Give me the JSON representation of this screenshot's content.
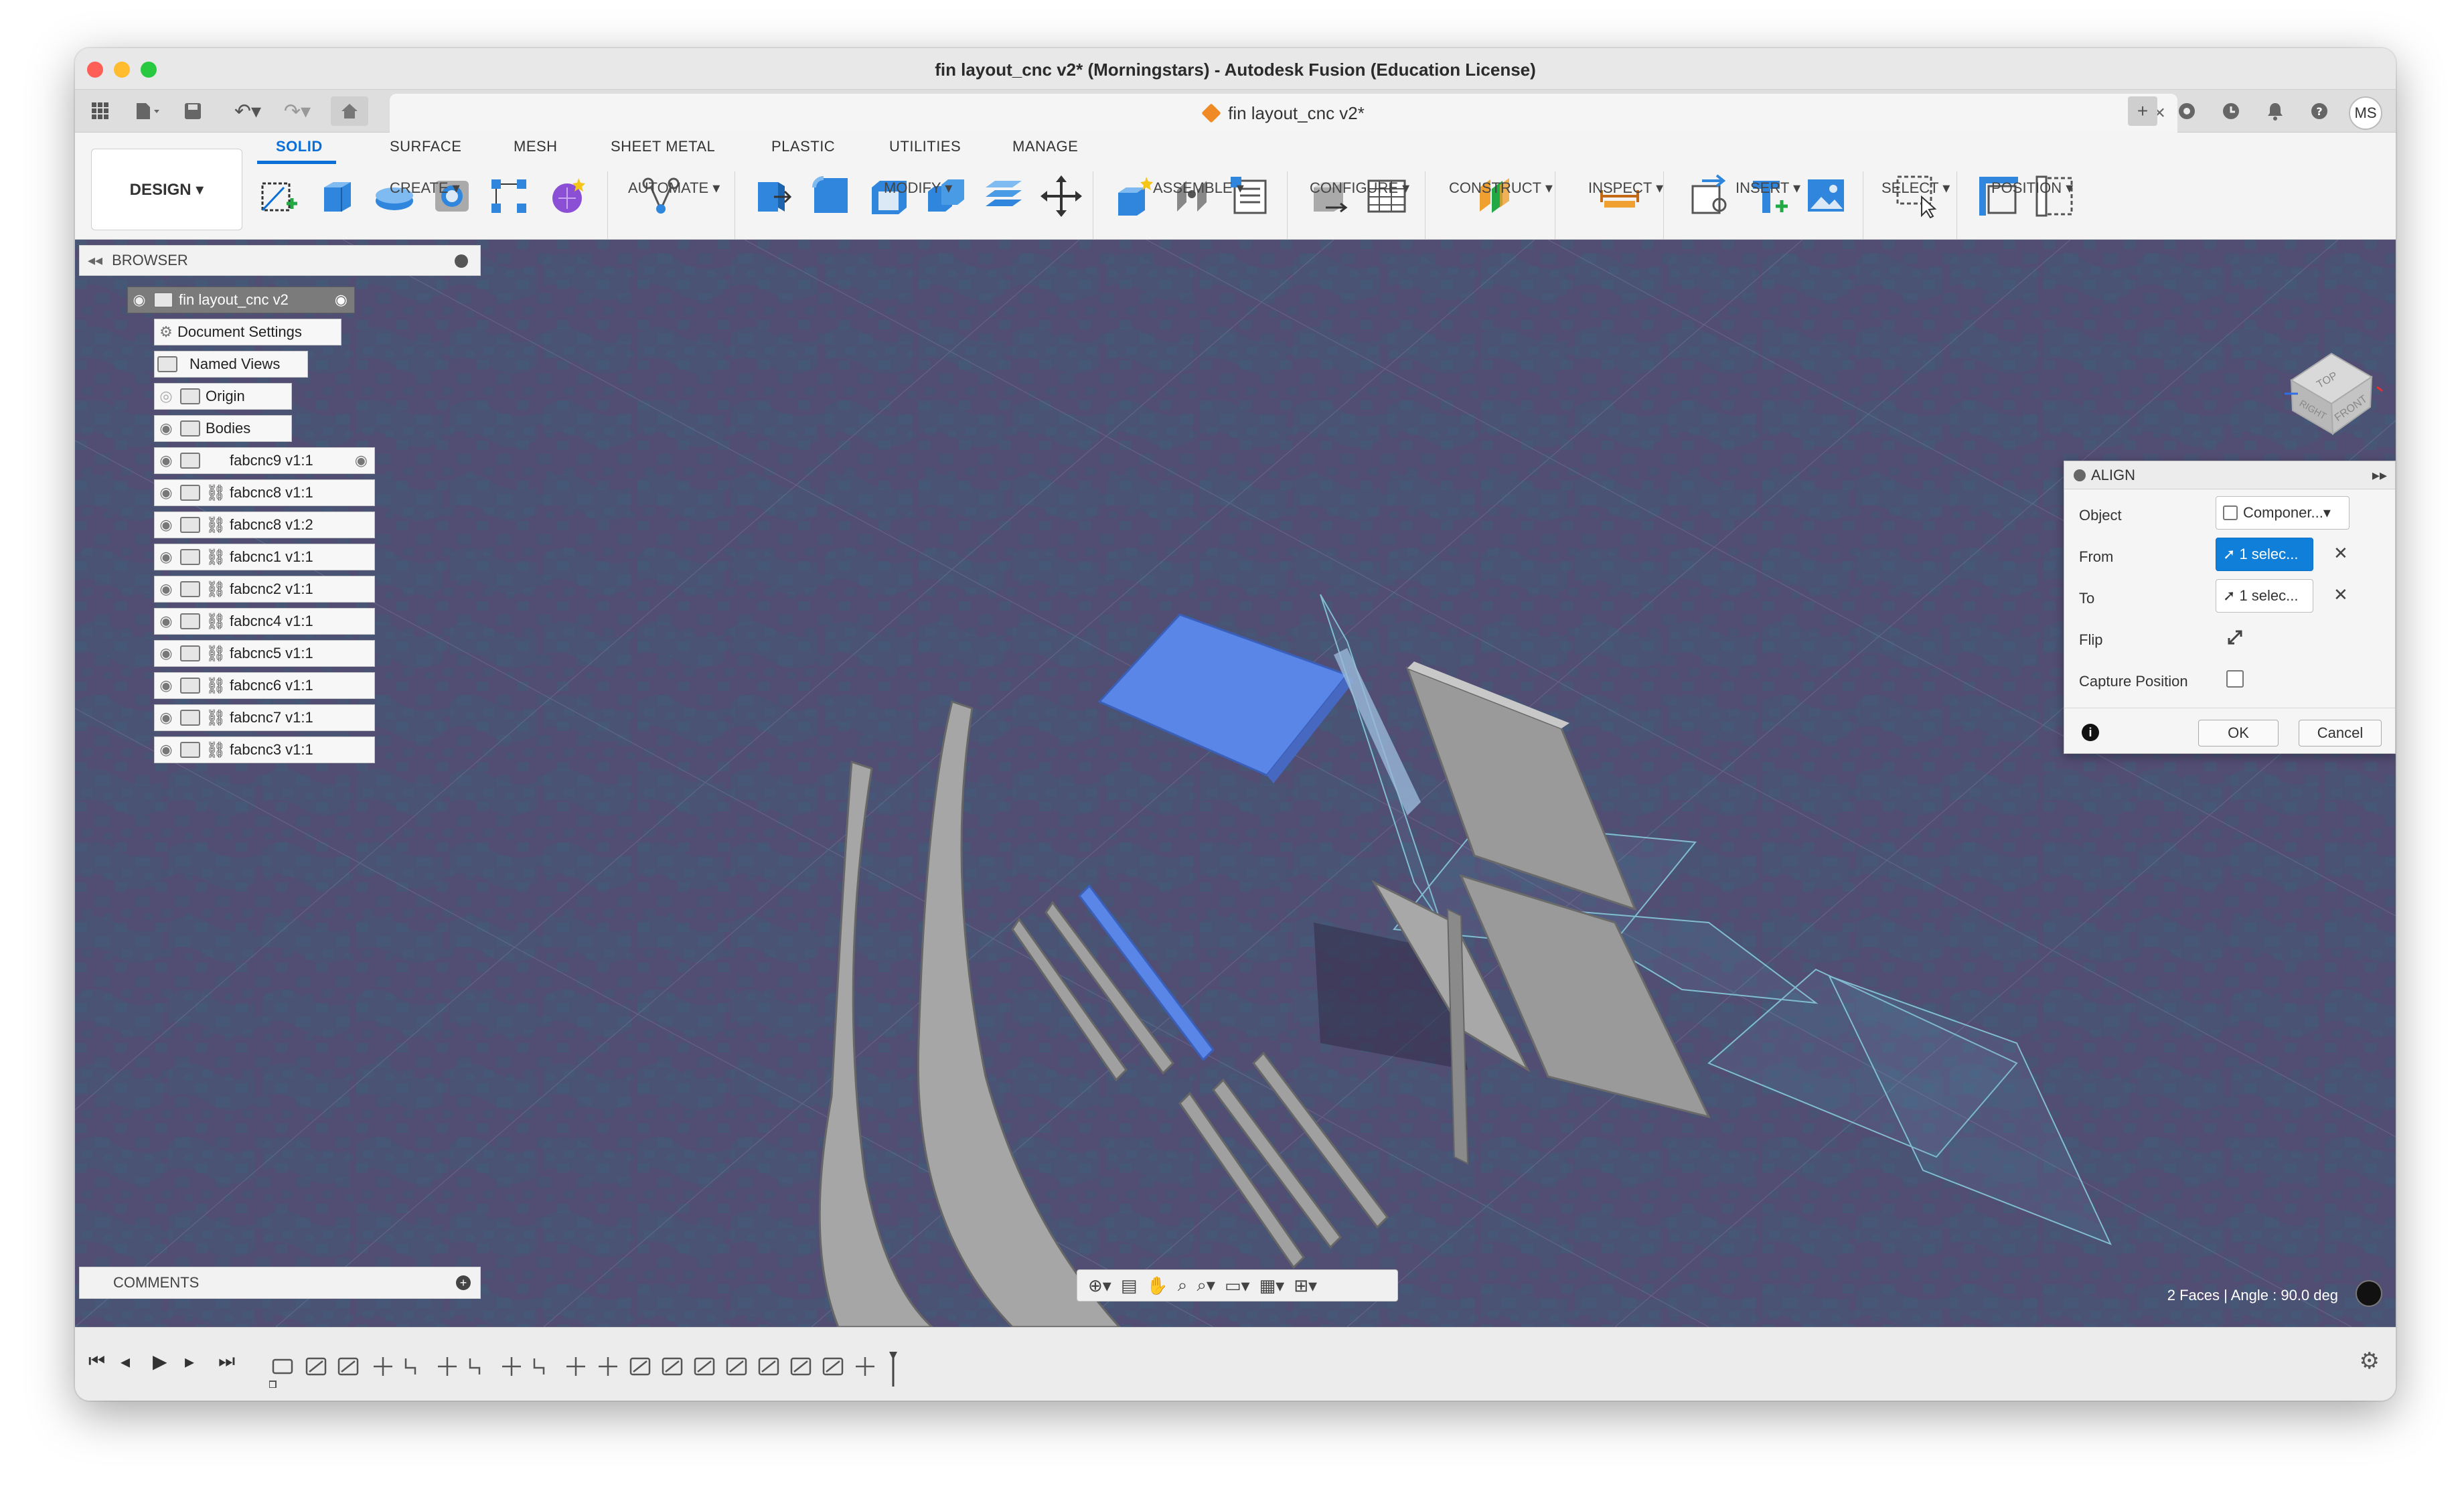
{
  "window": {
    "title": "fin layout_cnc v2* (Morningstars) - Autodesk Fusion (Education License)"
  },
  "document_tab": {
    "label": "fin layout_cnc v2*",
    "close": "×"
  },
  "user": {
    "initials": "MS"
  },
  "workspace": {
    "label": "DESIGN ▾"
  },
  "ribbon": {
    "tabs": [
      "SOLID",
      "SURFACE",
      "MESH",
      "SHEET METAL",
      "PLASTIC",
      "UTILITIES",
      "MANAGE"
    ],
    "active_tab": "SOLID",
    "groups": [
      "CREATE ▾",
      "AUTOMATE ▾",
      "MODIFY ▾",
      "ASSEMBLE ▾",
      "CONFIGURE ▾",
      "CONSTRUCT ▾",
      "INSPECT ▾",
      "INSERT ▾",
      "SELECT ▾",
      "POSITION ▾"
    ]
  },
  "browser": {
    "title": "BROWSER",
    "root": "fin layout_cnc v2",
    "nodes": [
      {
        "label": "Document Settings"
      },
      {
        "label": "Named Views"
      },
      {
        "label": "Origin"
      },
      {
        "label": "Bodies"
      },
      {
        "label": "fabcnc9 v1:1"
      },
      {
        "label": "fabcnc8 v1:1"
      },
      {
        "label": "fabcnc8 v1:2"
      },
      {
        "label": "fabcnc1 v1:1"
      },
      {
        "label": "fabcnc2 v1:1"
      },
      {
        "label": "fabcnc4 v1:1"
      },
      {
        "label": "fabcnc5 v1:1"
      },
      {
        "label": "fabcnc6 v1:1"
      },
      {
        "label": "fabcnc7 v1:1"
      },
      {
        "label": "fabcnc3 v1:1"
      }
    ]
  },
  "comments": {
    "title": "COMMENTS"
  },
  "align_dialog": {
    "title": "ALIGN",
    "object_label": "Object",
    "object_value": "Componer...▾",
    "from_label": "From",
    "from_value": "1 selec...",
    "to_label": "To",
    "to_value": "1 selec...",
    "flip_label": "Flip",
    "capture_label": "Capture Position",
    "ok": "OK",
    "cancel": "Cancel"
  },
  "viewcube": {
    "top": "TOP",
    "front": "FRONT",
    "right": "RIGHT"
  },
  "status": {
    "text": "2 Faces | Angle : 90.0 deg"
  },
  "colors": {
    "viewport": "#524d72",
    "selection": "#5a86e8",
    "part": "#9a9a9a",
    "accent": "#0a6fd6"
  }
}
